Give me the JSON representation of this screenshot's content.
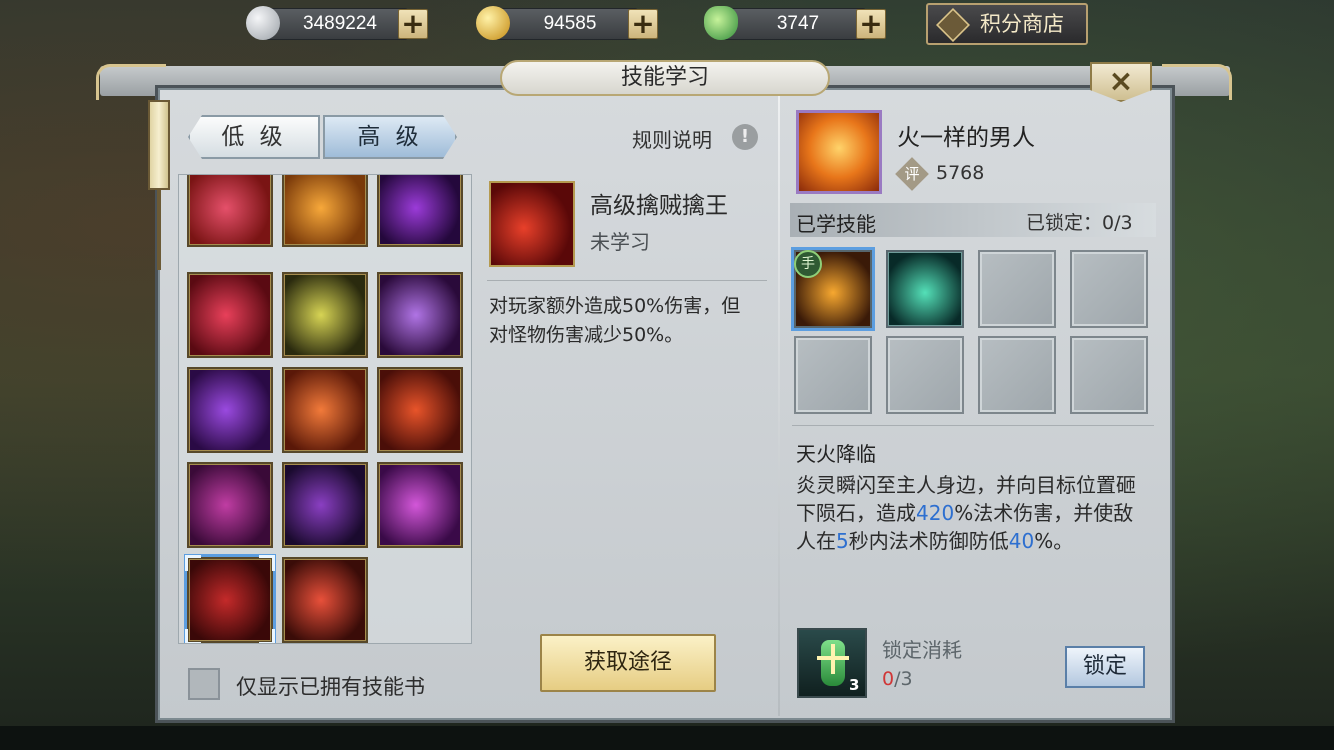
{
  "currency": [
    {
      "icon": "silver-coin-icon",
      "value": "3489224",
      "color": "#c9ccd0"
    },
    {
      "icon": "gold-coin-icon",
      "value": "94585",
      "color": "#e8b930"
    },
    {
      "icon": "ingot-icon",
      "value": "3747",
      "color": "#5fb35a"
    }
  ],
  "plus_label": "+",
  "shop_label": "积分商店",
  "title": "技能学习",
  "close_label": "×",
  "tabs": {
    "low": "低 级",
    "high": "高 级"
  },
  "rules_label": "规则说明",
  "rules_icon": "!",
  "skill_grid": [
    {
      "name": "skill-1",
      "c1": "#7a1414",
      "c2": "#e5506a"
    },
    {
      "name": "skill-2",
      "c1": "#7a3a0a",
      "c2": "#f7a83a"
    },
    {
      "name": "skill-3",
      "c1": "#24083c",
      "c2": "#9b3bd9"
    },
    {
      "name": "skill-4",
      "c1": "#5a0a12",
      "c2": "#e8405a"
    },
    {
      "name": "skill-5",
      "c1": "#2a2a0e",
      "c2": "#d7d454"
    },
    {
      "name": "skill-6",
      "c1": "#2a0a3a",
      "c2": "#b074e5"
    },
    {
      "name": "skill-7",
      "c1": "#2a0a45",
      "c2": "#9a4ae0"
    },
    {
      "name": "skill-8",
      "c1": "#5a1808",
      "c2": "#f27a3a"
    },
    {
      "name": "skill-9",
      "c1": "#4a0e08",
      "c2": "#e8542a"
    },
    {
      "name": "skill-10",
      "c1": "#3a0a38",
      "c2": "#c03da3"
    },
    {
      "name": "skill-11",
      "c1": "#1a0a2e",
      "c2": "#8a3fc2"
    },
    {
      "name": "skill-12",
      "c1": "#3a0a48",
      "c2": "#d357d9"
    },
    {
      "name": "skill-13",
      "c1": "#3a0808",
      "c2": "#c42a2a"
    },
    {
      "name": "skill-14",
      "c1": "#3a0c08",
      "c2": "#e8503a"
    }
  ],
  "filter_label": "仅显示已拥有技能书",
  "selected_skill": {
    "name": "高级擒贼擒王",
    "status": "未学习",
    "description": "对玩家额外造成50%伤害，但对怪物伤害减少50%。"
  },
  "get_button": "获取途径",
  "player": {
    "name": "火一样的男人",
    "score_icon_text": "评",
    "score": "5768"
  },
  "learned": {
    "title": "已学技能",
    "lock_count": "已锁定：0/3",
    "hand_badge": "手"
  },
  "learned_slots": [
    {
      "filled": true,
      "c1": "#3a1a08",
      "c2": "#f7a830",
      "selected": true
    },
    {
      "filled": true,
      "c1": "#082a28",
      "c2": "#54e0b8",
      "selected": false
    },
    {
      "filled": false
    },
    {
      "filled": false
    },
    {
      "filled": false
    },
    {
      "filled": false
    },
    {
      "filled": false
    },
    {
      "filled": false
    }
  ],
  "active_skill": {
    "name": "天火降临",
    "desc_parts": [
      "炎灵瞬闪至主人身边，并向目标位置砸下陨石，造成",
      "420",
      "%法术伤害，并使敌人在",
      "5",
      "秒内法术防御防低",
      "40",
      "%。"
    ]
  },
  "lock_cost": {
    "label": "锁定消耗",
    "current": "0",
    "total": "/3",
    "item_count": "3"
  },
  "lock_button": "锁定"
}
